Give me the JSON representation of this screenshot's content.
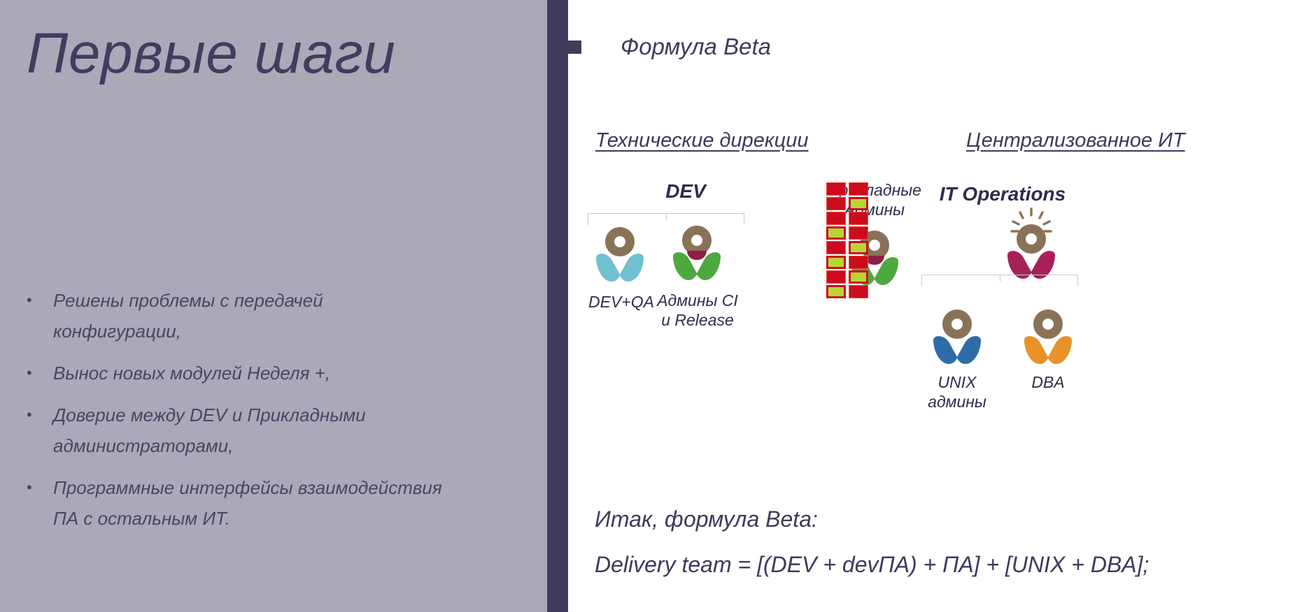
{
  "slide": {
    "title": "Первые шаги",
    "accent_dark": "#413a5c",
    "panel_bg": "#aaa9b8",
    "text_color": "#4a4560"
  },
  "bullets": [
    {
      "marker": "•",
      "text": "Решены проблемы с передачей конфигурации,"
    },
    {
      "marker": "•",
      "text": "Вынос новых модулей Неделя +,"
    },
    {
      "marker": "•",
      "text": " Доверие между DEV и Прикладными администраторами,"
    },
    {
      "marker": "•",
      "text": "Программные интерфейсы взаимодействия ПА с остальным ИТ."
    }
  ],
  "right": {
    "heading": "Формула Beta",
    "heading_bullet": "square-bullet",
    "section_headers": {
      "technical": "Технические дирекции",
      "centralized": "Централизованное ИТ"
    },
    "groups": {
      "dev_title": "DEV",
      "itops_title": "IT Operations",
      "prikladnye_caption": "Прикладные\nАдмины"
    },
    "people": [
      {
        "id": "dev-qa",
        "label": "DEV+QA",
        "body_color": "#6fc0d0",
        "head_color": "#8a7257",
        "collar": false
      },
      {
        "id": "admins-ci",
        "label": "Админы CI\nи Release",
        "body_color": "#4fa83f",
        "head_color": "#8a7257",
        "collar": true
      },
      {
        "id": "prikladnye",
        "label": "",
        "body_color": "#4fa83f",
        "head_color": "#8a7257",
        "collar": true
      },
      {
        "id": "it-ops",
        "label": "",
        "body_color": "#a8205a",
        "head_color": "#8a7257",
        "collar": false,
        "rays": true
      },
      {
        "id": "unix",
        "label": "UNIX\nадмины",
        "body_color": "#2f6ca5",
        "head_color": "#8a7257",
        "collar": false
      },
      {
        "id": "dba",
        "label": "DBA",
        "body_color": "#e89228",
        "head_color": "#8a7257",
        "collar": false
      }
    ],
    "server_grid": {
      "rows": 8,
      "cols": 2,
      "red": "#cc0c1e",
      "yellow": "#b8d636",
      "pattern": [
        [
          "red",
          "red"
        ],
        [
          "red",
          "yellow"
        ],
        [
          "red",
          "red"
        ],
        [
          "yellow",
          "red"
        ],
        [
          "red",
          "yellow"
        ],
        [
          "yellow",
          "red"
        ],
        [
          "red",
          "yellow"
        ],
        [
          "yellow",
          "red"
        ]
      ]
    },
    "formula": {
      "intro": "Итак, формула Beta:",
      "body": "Delivery team = [(DEV + devПА) + ПА] + [UNIX + DBA];"
    }
  }
}
